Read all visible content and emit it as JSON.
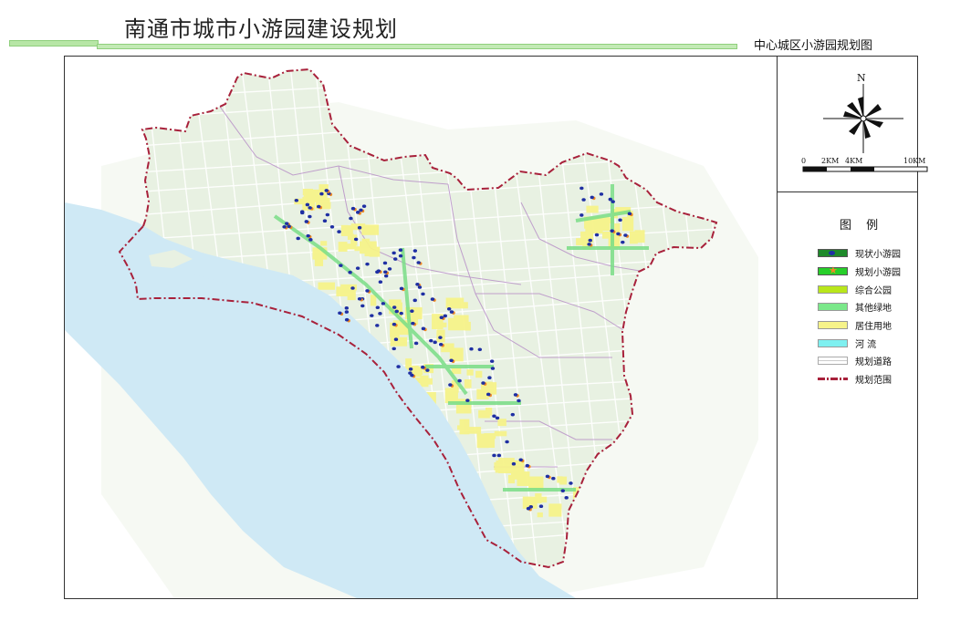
{
  "header": {
    "title": "南通市城市小游园建设规划",
    "subtitle": "中心城区小游园规划图"
  },
  "compass": {
    "north_label": "N",
    "icon": "compass-rose-icon"
  },
  "scale_bar": {
    "labels": [
      "0",
      "2KM",
      "4KM",
      "10KM"
    ]
  },
  "legend": {
    "title": "图 例",
    "items": [
      {
        "label": "现状小游园",
        "color": "#1e8a2a",
        "symbol": "blue-dot-icon"
      },
      {
        "label": "规划小游园",
        "color": "#27cf2a",
        "symbol": "orange-star-icon"
      },
      {
        "label": "综合公园",
        "color": "#b9e61b"
      },
      {
        "label": "其他绿地",
        "color": "#7be88a"
      },
      {
        "label": "居住用地",
        "color": "#f6f38a"
      },
      {
        "label": "河  流",
        "color": "#7ff0f0"
      },
      {
        "label": "规划道路",
        "color": "#ffffff",
        "symbol": "road-lines-icon"
      },
      {
        "label": "规划范围",
        "color": "#a8213b",
        "symbol": "dash-dot-line-icon"
      }
    ]
  },
  "colors": {
    "river": "#cfe9f5",
    "land": "#e8f1e2",
    "boundary": "#a8213b",
    "green": "#8fe39a",
    "residential": "#f6f38a",
    "existing_park_dot": "#1f2fa3",
    "planned_park_star": "#f08a24"
  }
}
